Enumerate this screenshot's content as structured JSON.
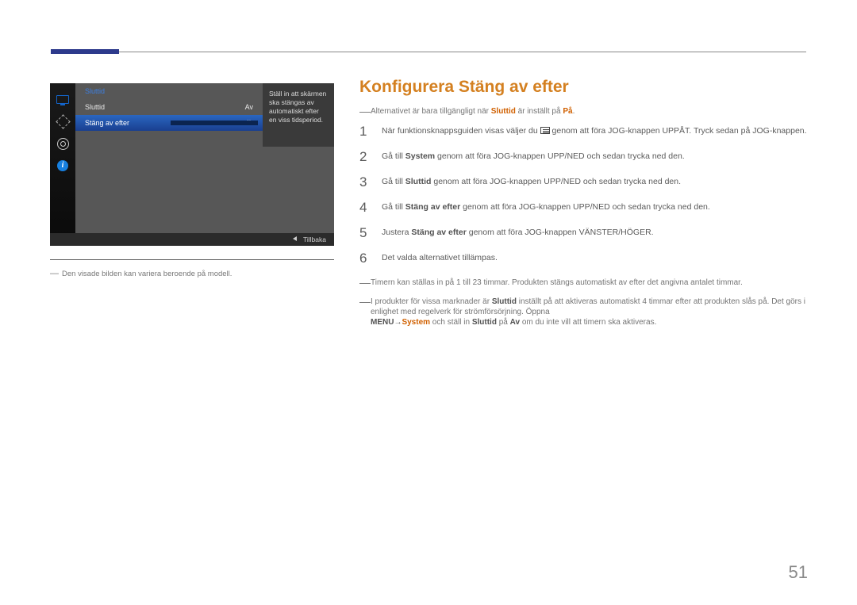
{
  "page_number": "51",
  "osd": {
    "header": "Sluttid",
    "row_label_1": "Sluttid",
    "row_value_1": "Av",
    "row_label_2": "Stäng av efter",
    "row_value_2": "4h",
    "desc": "Ställ in att skärmen ska stängas av automatiskt efter en viss tidsperiod.",
    "back": "Tillbaka"
  },
  "caption": "Den visade bilden kan variera beroende på modell.",
  "title": "Konfigurera Stäng av efter",
  "note1": {
    "pre": "Alternativet är bara tillgängligt när ",
    "em": "Sluttid",
    "mid": " är inställt på ",
    "em2": "På",
    "post": "."
  },
  "steps": {
    "s1a": "När funktionsknappsguiden visas väljer du ",
    "s1b": " genom att föra JOG-knappen UPPÅT. Tryck sedan på JOG-knappen.",
    "s2a": "Gå till ",
    "s2em": "System",
    "s2b": " genom att föra JOG-knappen UPP/NED och sedan trycka ned den.",
    "s3a": "Gå till ",
    "s3em": "Sluttid",
    "s3b": " genom att föra JOG-knappen UPP/NED och sedan trycka ned den.",
    "s4a": "Gå till ",
    "s4em": "Stäng av efter",
    "s4b": " genom att föra JOG-knappen UPP/NED och sedan trycka ned den.",
    "s5a": "Justera ",
    "s5em": "Stäng av efter",
    "s5b": " genom att föra JOG-knappen VÄNSTER/HÖGER.",
    "s6": "Det valda alternativet tillämpas."
  },
  "note2": "Timern kan ställas in på 1 till 23 timmar. Produkten stängs automatiskt av efter det angivna antalet timmar.",
  "note3": {
    "a": "I produkter för vissa marknader är ",
    "em1": "Sluttid",
    "b": " inställt på att aktiveras automatiskt 4 timmar efter att produkten slås på. Det görs i enlighet med regelverk för strömförsörjning. Öppna",
    "menu": "MENU",
    "arrow": " → ",
    "sys": "System",
    "c": " och ställ in ",
    "em2": "Sluttid",
    "d": " på ",
    "em3": "Av",
    "e": " om du inte vill att timern ska aktiveras."
  }
}
